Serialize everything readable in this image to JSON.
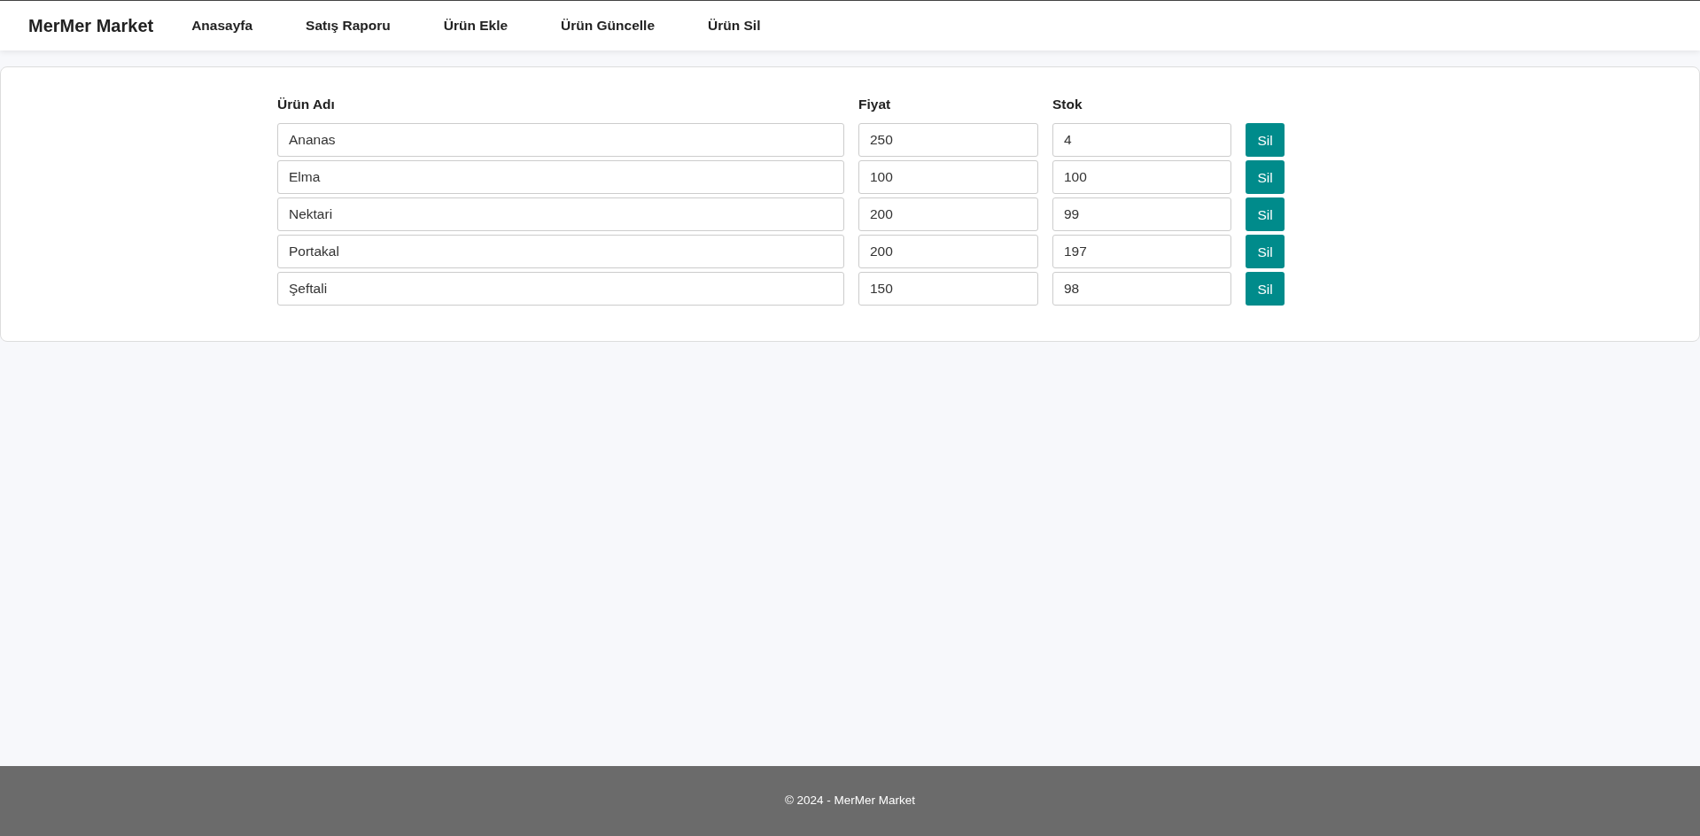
{
  "navbar": {
    "brand": "MerMer Market",
    "links": [
      {
        "label": "Anasayfa"
      },
      {
        "label": "Satış Raporu"
      },
      {
        "label": "Ürün Ekle"
      },
      {
        "label": "Ürün Güncelle"
      },
      {
        "label": "Ürün Sil"
      }
    ]
  },
  "table": {
    "columns": [
      "Ürün Adı",
      "Fiyat",
      "Stok"
    ],
    "rows": [
      {
        "name": "Ananas",
        "price": "250",
        "stock": "4",
        "button": "Sil"
      },
      {
        "name": "Elma",
        "price": "100",
        "stock": "100",
        "button": "Sil"
      },
      {
        "name": "Nektari",
        "price": "200",
        "stock": "99",
        "button": "Sil"
      },
      {
        "name": "Portakal",
        "price": "200",
        "stock": "197",
        "button": "Sil"
      },
      {
        "name": "Şeftali",
        "price": "150",
        "stock": "98",
        "button": "Sil"
      }
    ]
  },
  "footer": {
    "text": "© 2024 - MerMer Market"
  }
}
